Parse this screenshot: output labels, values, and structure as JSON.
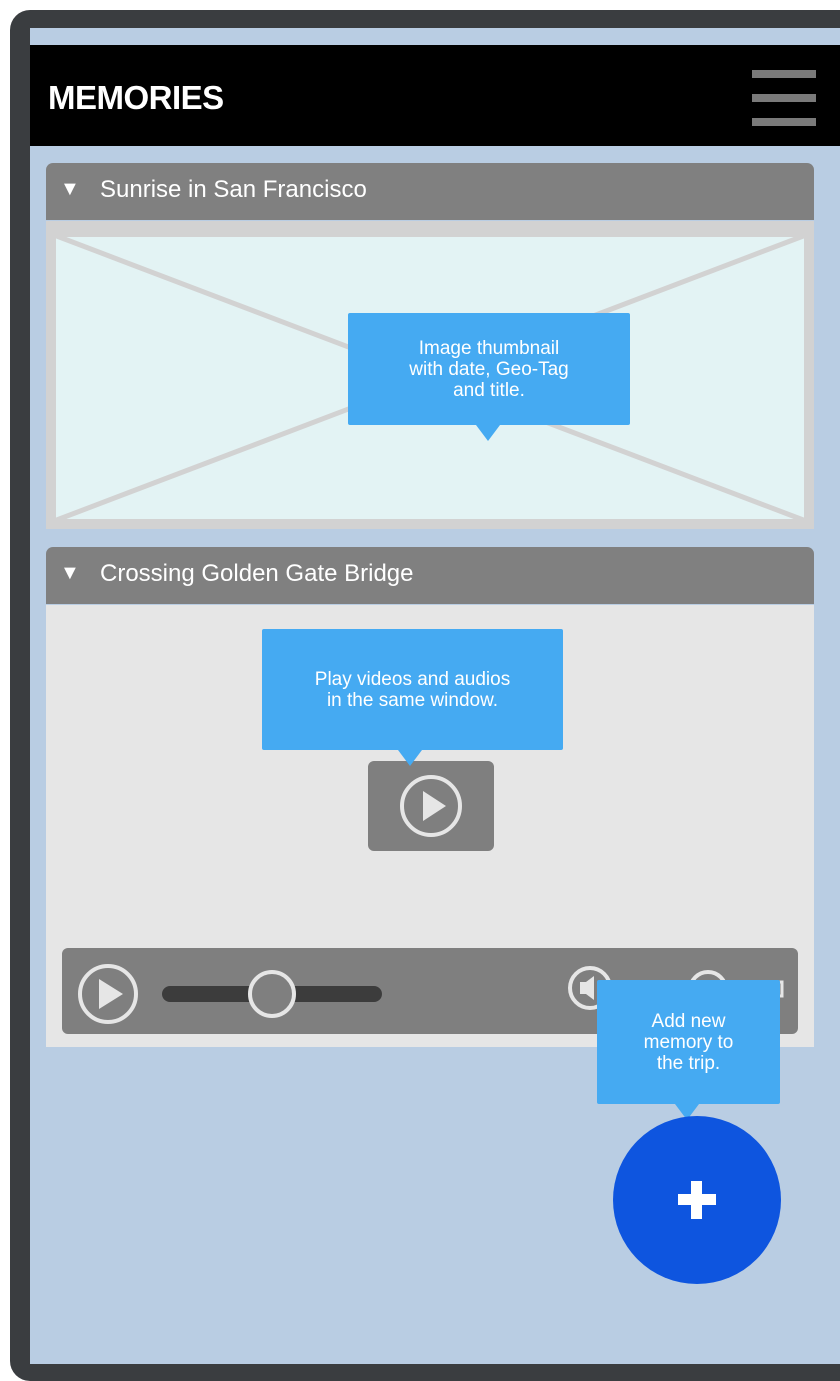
{
  "app": {
    "title": "MEMORIES",
    "menu_icon": "hamburger-icon"
  },
  "memories": [
    {
      "title": "Sunrise in San Francisco",
      "type": "image",
      "expanded": true,
      "placeholder_icon": "image-placeholder-icon"
    },
    {
      "title": "Crossing Golden Gate Bridge",
      "type": "video",
      "expanded": true,
      "player": {
        "play_icon": "play-icon",
        "volume_icon": "volume-icon",
        "fullscreen_icon": "fullscreen-icon"
      }
    }
  ],
  "annotations": {
    "thumbnail": "Image thumbnail\nwith date, Geo-Tag\nand title.",
    "player": "Play videos and audios\nin the same window.",
    "add": "Add new\nmemory to\nthe trip."
  },
  "fab": {
    "icon": "plus-icon",
    "color": "#0e55df"
  },
  "colors": {
    "screen_bg": "#b9cde3",
    "header_bg": "#000000",
    "card_header_bg": "#808080",
    "callout_bg": "#45aaf2",
    "thumbnail_bg": "#e3f3f4"
  }
}
